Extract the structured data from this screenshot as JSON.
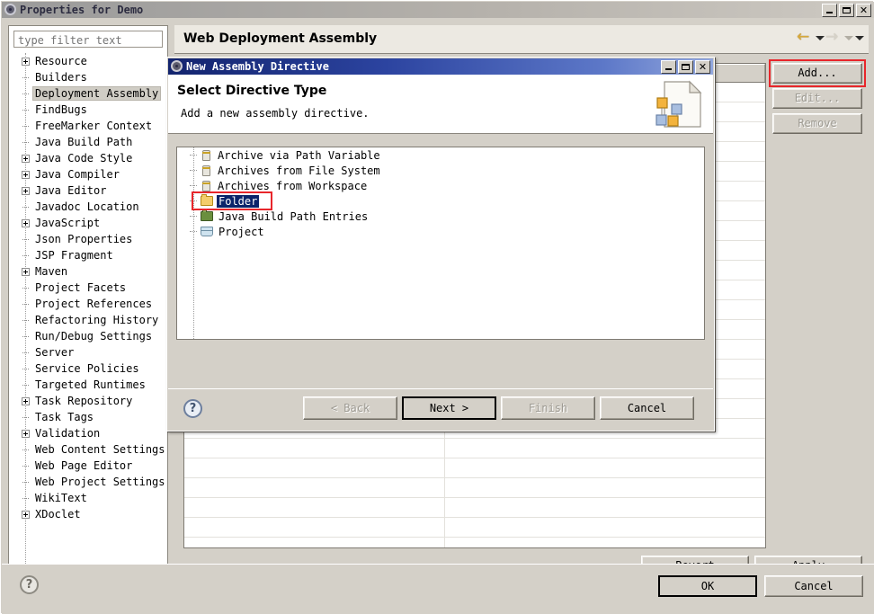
{
  "window": {
    "title": "Properties for Demo",
    "icon": "gear-icon",
    "controls": {
      "minimize": "_",
      "maximize": "□",
      "close": "✕"
    }
  },
  "sidebar": {
    "filter": {
      "placeholder": "type filter text",
      "value": ""
    },
    "items": [
      {
        "label": "Resource",
        "expandable": true,
        "selected": false
      },
      {
        "label": "Builders",
        "expandable": false,
        "selected": false
      },
      {
        "label": "Deployment Assembly",
        "expandable": false,
        "selected": true
      },
      {
        "label": "FindBugs",
        "expandable": false,
        "selected": false
      },
      {
        "label": "FreeMarker Context",
        "expandable": false,
        "selected": false
      },
      {
        "label": "Java Build Path",
        "expandable": false,
        "selected": false
      },
      {
        "label": "Java Code Style",
        "expandable": true,
        "selected": false
      },
      {
        "label": "Java Compiler",
        "expandable": true,
        "selected": false
      },
      {
        "label": "Java Editor",
        "expandable": true,
        "selected": false
      },
      {
        "label": "Javadoc Location",
        "expandable": false,
        "selected": false
      },
      {
        "label": "JavaScript",
        "expandable": true,
        "selected": false
      },
      {
        "label": "Json Properties",
        "expandable": false,
        "selected": false
      },
      {
        "label": "JSP Fragment",
        "expandable": false,
        "selected": false
      },
      {
        "label": "Maven",
        "expandable": true,
        "selected": false
      },
      {
        "label": "Project Facets",
        "expandable": false,
        "selected": false
      },
      {
        "label": "Project References",
        "expandable": false,
        "selected": false
      },
      {
        "label": "Refactoring History",
        "expandable": false,
        "selected": false
      },
      {
        "label": "Run/Debug Settings",
        "expandable": false,
        "selected": false
      },
      {
        "label": "Server",
        "expandable": false,
        "selected": false
      },
      {
        "label": "Service Policies",
        "expandable": false,
        "selected": false
      },
      {
        "label": "Targeted Runtimes",
        "expandable": false,
        "selected": false
      },
      {
        "label": "Task Repository",
        "expandable": true,
        "selected": false
      },
      {
        "label": "Task Tags",
        "expandable": false,
        "selected": false
      },
      {
        "label": "Validation",
        "expandable": true,
        "selected": false
      },
      {
        "label": "Web Content Settings",
        "expandable": false,
        "selected": false
      },
      {
        "label": "Web Page Editor",
        "expandable": false,
        "selected": false
      },
      {
        "label": "Web Project Settings",
        "expandable": false,
        "selected": false
      },
      {
        "label": "WikiText",
        "expandable": false,
        "selected": false
      },
      {
        "label": "XDoclet",
        "expandable": true,
        "selected": false
      }
    ]
  },
  "page": {
    "title": "Web Deployment Assembly",
    "nav": {
      "back_icon": "back-arrow-icon",
      "back_dropdown_icon": "chevron-down-icon",
      "forward_icon": "forward-arrow-icon",
      "forward_dropdown_icon": "chevron-down-icon",
      "menu_icon": "chevron-down-icon"
    },
    "table": {
      "columns": [
        "",
        ""
      ],
      "rows": [
        [
          "",
          ""
        ],
        [
          "",
          ""
        ],
        [
          "",
          ""
        ],
        [
          "",
          ""
        ],
        [
          "",
          ""
        ],
        [
          "",
          ""
        ],
        [
          "",
          ""
        ],
        [
          "",
          ""
        ],
        [
          "",
          ""
        ],
        [
          "",
          ""
        ],
        [
          "",
          ""
        ],
        [
          "",
          ""
        ],
        [
          "",
          ""
        ],
        [
          "",
          ""
        ],
        [
          "",
          ""
        ],
        [
          "",
          ""
        ],
        [
          "",
          ""
        ],
        [
          "",
          ""
        ],
        [
          "",
          ""
        ],
        [
          "",
          ""
        ],
        [
          "",
          ""
        ],
        [
          "",
          ""
        ],
        [
          "",
          ""
        ],
        [
          "",
          ""
        ]
      ]
    },
    "buttons": {
      "add": {
        "label": "Add...",
        "enabled": true,
        "highlighted": true
      },
      "edit": {
        "label": "Edit...",
        "enabled": false
      },
      "remove": {
        "label": "Remove",
        "enabled": false
      },
      "revert": {
        "label": "Revert",
        "enabled": true
      },
      "apply": {
        "label": "Apply",
        "enabled": true
      }
    }
  },
  "footer": {
    "help_icon": "help-icon",
    "ok": "OK",
    "cancel": "Cancel"
  },
  "wizard": {
    "title": "New Assembly Directive",
    "icon": "gear-icon",
    "controls": {
      "minimize": "_",
      "maximize": "□",
      "close": "✕"
    },
    "header": {
      "title": "Select Directive Type",
      "subtitle": "Add a new assembly directive.",
      "banner_icon": "wizard-page-icon"
    },
    "directives": [
      {
        "label": "Archive via Path Variable",
        "icon": "jar-icon",
        "selected": false
      },
      {
        "label": "Archives from File System",
        "icon": "jar-icon",
        "selected": false
      },
      {
        "label": "Archives from Workspace",
        "icon": "jar-icon",
        "selected": false
      },
      {
        "label": "Folder",
        "icon": "folder-icon",
        "selected": true
      },
      {
        "label": "Java Build Path Entries",
        "icon": "java-build-path-icon",
        "selected": false
      },
      {
        "label": "Project",
        "icon": "project-icon",
        "selected": false
      }
    ],
    "help_icon": "help-icon",
    "buttons": {
      "back": {
        "label": "< Back",
        "enabled": false
      },
      "next": {
        "label": "Next >",
        "enabled": true,
        "default": true
      },
      "finish": {
        "label": "Finish",
        "enabled": false
      },
      "cancel": {
        "label": "Cancel",
        "enabled": true
      }
    }
  },
  "annotations": {
    "color": "#e8262b",
    "boxes": [
      "add-button",
      "folder-directive-row"
    ]
  }
}
